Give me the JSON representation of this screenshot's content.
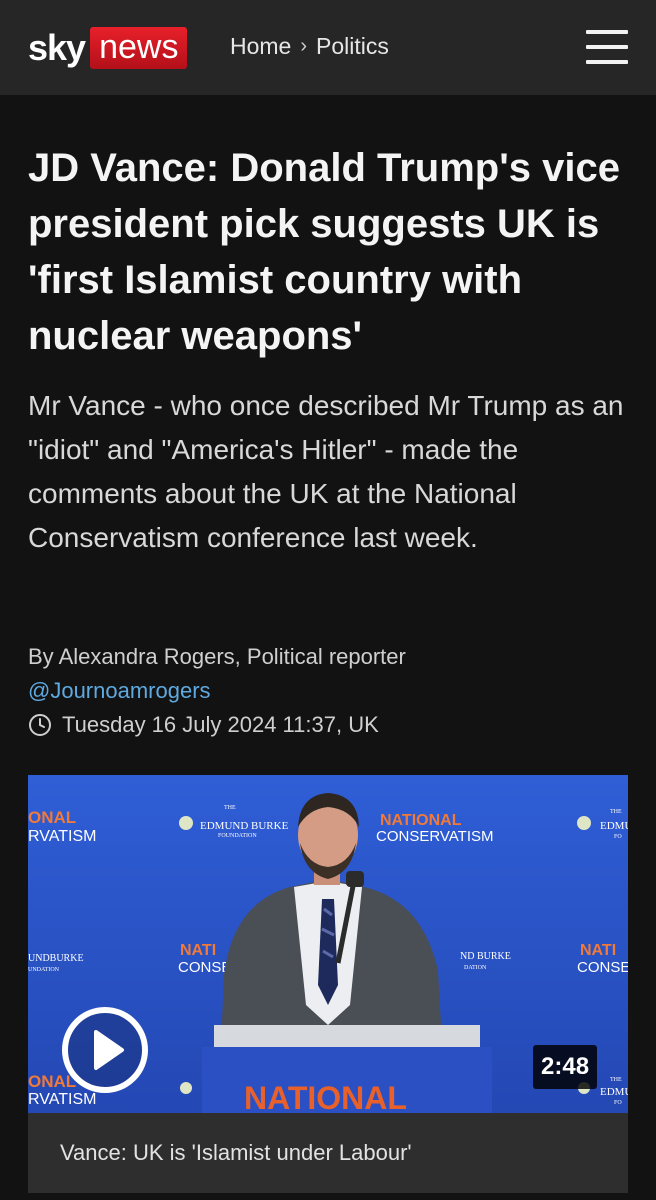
{
  "header": {
    "logo_sky": "sky",
    "logo_news": "news",
    "breadcrumb": {
      "home": "Home",
      "separator": "›",
      "section": "Politics"
    },
    "menu_icon": "hamburger-menu-icon"
  },
  "article": {
    "headline": "JD Vance: Donald Trump's vice president pick suggests UK is 'first Islamist country with nuclear weapons'",
    "standfirst": "Mr Vance - who once described Mr Trump as an \"idiot\" and \"America's Hitler\" - made the comments about the UK at the National Conservatism conference last week.",
    "author": "By Alexandra Rogers, Political reporter",
    "handle": "@Journoamrogers",
    "date": "Tuesday 16 July 2024 11:37, UK"
  },
  "video": {
    "duration": "2:48",
    "caption": "Vance: UK is 'Islamist under Labour'",
    "play_icon": "play-icon",
    "backdrop": {
      "national": "NATIONAL",
      "conservatism": "CONSERVATISM",
      "the": "THE",
      "edmund_burke": "EDMUND BURKE",
      "foundation": "FOUNDATION",
      "onal": "ONAL",
      "rvatism": "RVATISM",
      "undburke": "UNDBURKE",
      "undation": "UNDATION",
      "nati": "NATI",
      "conse": "CONSE",
      "ndburke": "ND BURKE",
      "dation": "DATION",
      "edmu": "EDMU",
      "fo": "FO",
      "podium": "NATIONAL"
    }
  },
  "colors": {
    "background": "#121212",
    "header": "#262626",
    "news_red": "#d7141f",
    "link_blue": "#5ea9e0",
    "backdrop_blue": "#2b56c9",
    "podium_text": "#e8612a"
  }
}
